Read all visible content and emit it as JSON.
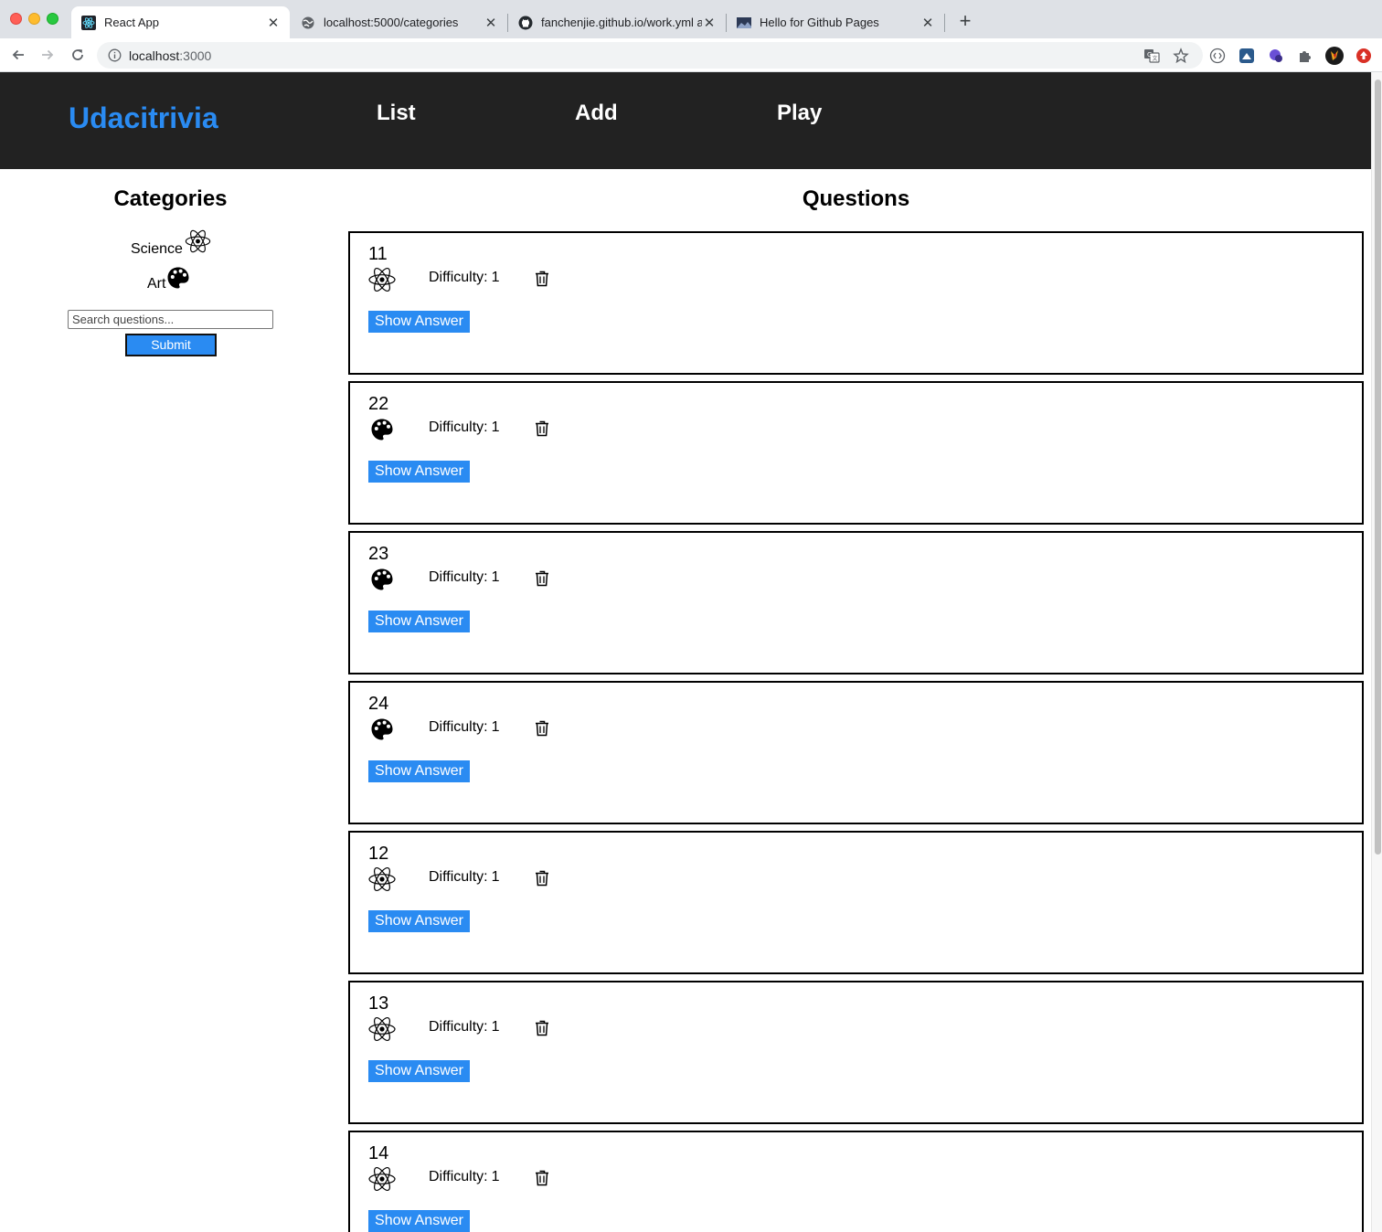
{
  "browser": {
    "tabs": [
      {
        "title": "React App",
        "favicon": "react-icon",
        "active": true
      },
      {
        "title": "localhost:5000/categories",
        "favicon": "globe-icon",
        "active": false
      },
      {
        "title": "fanchenjie.github.io/work.yml a",
        "favicon": "github-icon",
        "active": false
      },
      {
        "title": "Hello for Github Pages",
        "favicon": "image-icon",
        "active": false
      }
    ],
    "close_glyph": "✕",
    "new_tab_glyph": "+",
    "url_host": "localhost",
    "url_port": ":3000"
  },
  "header": {
    "logo": "Udacitrivia",
    "logo_color": "#2a8bf2",
    "nav": [
      "List",
      "Add",
      "Play"
    ]
  },
  "sidebar": {
    "title": "Categories",
    "categories": [
      {
        "label": "Science",
        "icon": "science-icon"
      },
      {
        "label": "Art",
        "icon": "art-icon"
      }
    ],
    "search_placeholder": "Search questions...",
    "submit_label": "Submit"
  },
  "main": {
    "title": "Questions",
    "difficulty_label": "Difficulty:",
    "show_answer_label": "Show Answer",
    "questions": [
      {
        "text": "11",
        "category": "science",
        "difficulty": "1"
      },
      {
        "text": "22",
        "category": "art",
        "difficulty": "1"
      },
      {
        "text": "23",
        "category": "art",
        "difficulty": "1"
      },
      {
        "text": "24",
        "category": "art",
        "difficulty": "1"
      },
      {
        "text": "12",
        "category": "science",
        "difficulty": "1"
      },
      {
        "text": "13",
        "category": "science",
        "difficulty": "1"
      },
      {
        "text": "14",
        "category": "science",
        "difficulty": "1"
      }
    ]
  },
  "colors": {
    "header_bg": "#222222",
    "accent": "#2a8bf2"
  }
}
